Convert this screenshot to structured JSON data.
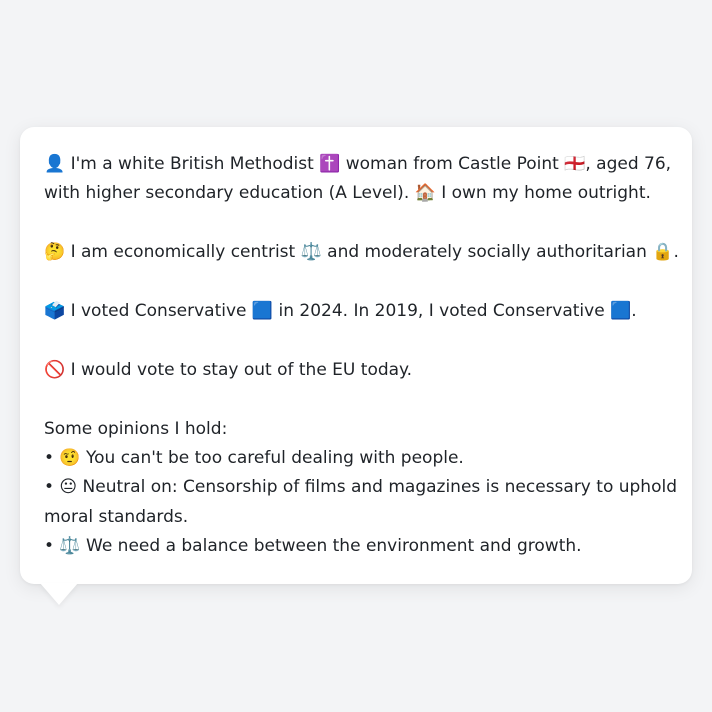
{
  "profile": {
    "intro_line1": "👤 I'm a white British Methodist ✝️ woman from Castle Point 🏴󠁧󠁢󠁥󠁮󠁧󠁿, aged 76,",
    "intro_line2": "with higher secondary education (A Level). 🏠 I own my home outright.",
    "politics_line": "🤔 I am economically centrist ⚖️ and moderately socially authoritarian 🔒.",
    "voting_line": "🗳️ I voted Conservative 🟦 in 2024. In 2019, I voted Conservative 🟦.",
    "eu_line": "🚫 I would vote to stay out of the EU today.",
    "opinions_header": "Some opinions I hold:",
    "opinion1": "• 🤨 You can't be too careful dealing with people.",
    "opinion2_line1": "• 😐 Neutral on: Censorship of films and magazines is necessary to uphold",
    "opinion2_line2": "moral standards.",
    "opinion3": "• ⚖️ We need a balance between the environment and growth."
  }
}
